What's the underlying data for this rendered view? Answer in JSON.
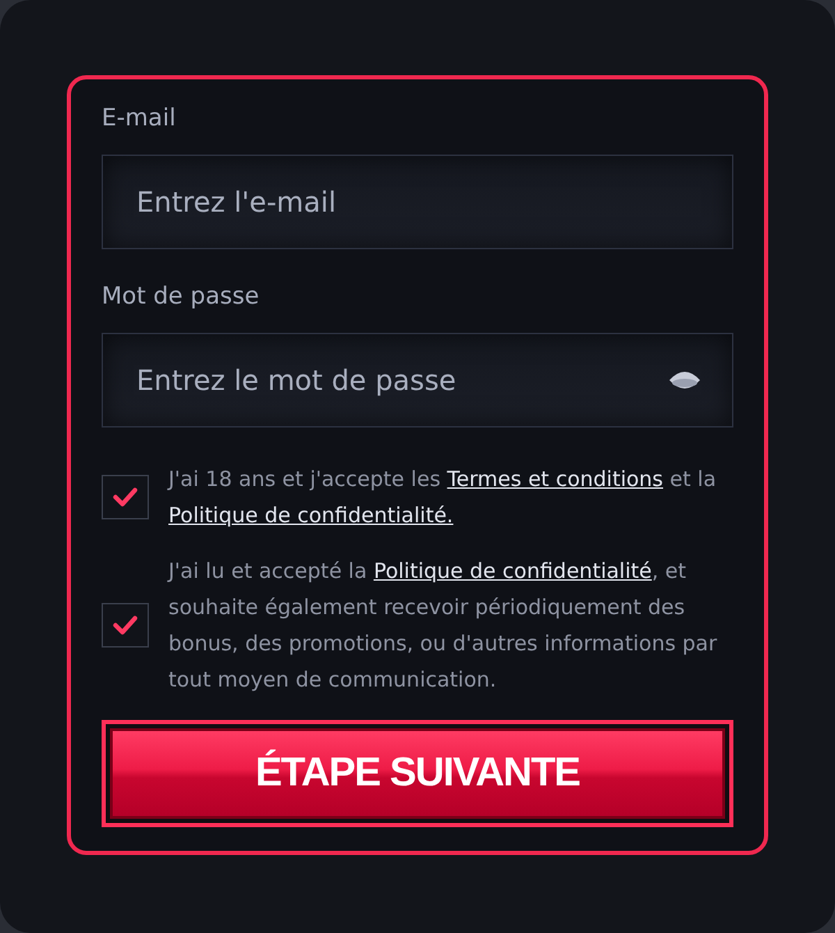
{
  "fields": [
    {
      "label": "E-mail",
      "placeholder": "Entrez l'e-mail",
      "kind": "email"
    },
    {
      "label": "Mot de passe",
      "placeholder": "Entrez le mot de passe",
      "kind": "password"
    }
  ],
  "consents": [
    {
      "checked": true,
      "parts": [
        {
          "text": "J'ai 18 ans et j'accepte les ",
          "link": false
        },
        {
          "text": "Termes et conditions",
          "link": true
        },
        {
          "text": " et la ",
          "link": false
        },
        {
          "text": "Politique de confidentialité.",
          "link": true
        }
      ]
    },
    {
      "checked": true,
      "parts": [
        {
          "text": "J'ai lu et accepté la ",
          "link": false
        },
        {
          "text": "Politique de confidentialité",
          "link": true
        },
        {
          "text": ", et souhaite également recevoir périodiquement des bonus, des promotions, ou d'autres informations par tout moyen de communication.",
          "link": false
        }
      ]
    }
  ],
  "submit": {
    "label": "ÉTAPE SUIVANTE"
  }
}
